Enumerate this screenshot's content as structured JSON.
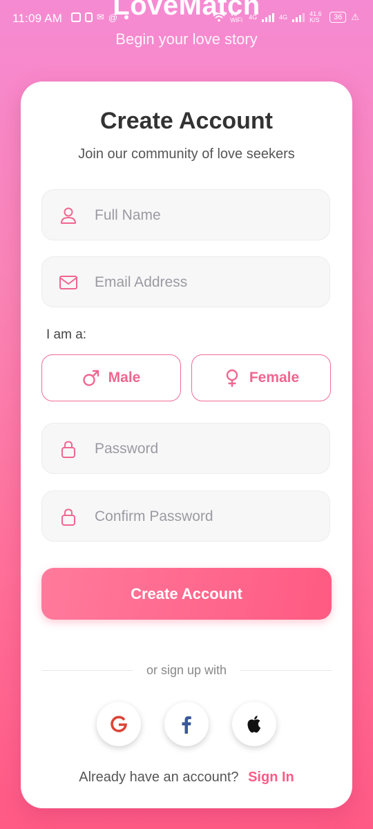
{
  "status_bar": {
    "time": "11:09 AM",
    "vo_wifi": "Vo WiFi",
    "network_1": "4G",
    "network_2": "4G",
    "speed": "41.6 K/S",
    "battery": "36"
  },
  "header": {
    "app_title": "LoveMatch",
    "subtitle": "Begin your love story"
  },
  "card": {
    "title": "Create Account",
    "subtitle": "Join our community of love seekers",
    "fields": {
      "full_name_placeholder": "Full Name",
      "email_placeholder": "Email Address",
      "password_placeholder": "Password",
      "confirm_password_placeholder": "Confirm Password"
    },
    "gender": {
      "label": "I am a:",
      "male": "Male",
      "female": "Female"
    },
    "submit_label": "Create Account",
    "divider_text": "or sign up with",
    "signin_prompt": "Already have an account?",
    "signin_link": "Sign In"
  },
  "colors": {
    "accent": "#ff5a86",
    "icon_pink": "#f0668f",
    "google_red": "#db4437",
    "facebook_blue": "#3b5998"
  },
  "icons": [
    "person-icon",
    "mail-icon",
    "male-icon",
    "female-icon",
    "lock-icon",
    "google-icon",
    "facebook-icon",
    "apple-icon"
  ]
}
